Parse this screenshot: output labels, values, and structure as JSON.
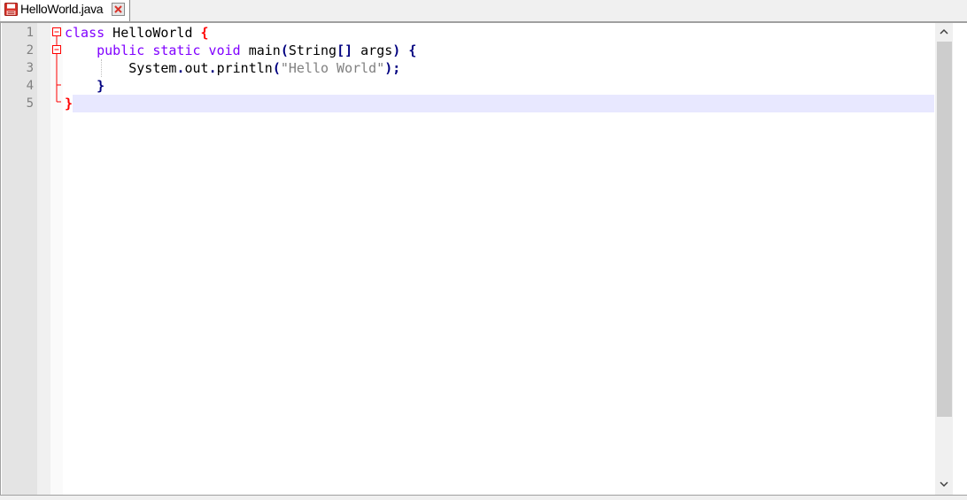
{
  "tab": {
    "label": "HelloWorld.java",
    "icon": "save-icon",
    "close_icon": "close-icon"
  },
  "editor": {
    "line_numbers": [
      "1",
      "2",
      "3",
      "4",
      "5"
    ],
    "lines": [
      {
        "indent": "",
        "tokens": [
          {
            "t": "class",
            "c": "kw"
          },
          {
            "t": " HelloWorld ",
            "c": ""
          },
          {
            "t": "{",
            "c": "brace-red"
          }
        ]
      },
      {
        "indent": "    ",
        "tokens": [
          {
            "t": "public static void",
            "c": "kw"
          },
          {
            "t": " main",
            "c": ""
          },
          {
            "t": "(",
            "c": "op"
          },
          {
            "t": "String",
            "c": ""
          },
          {
            "t": "[]",
            "c": "op"
          },
          {
            "t": " args",
            "c": ""
          },
          {
            "t": ")",
            "c": "op"
          },
          {
            "t": " {",
            "c": "brace"
          }
        ]
      },
      {
        "indent": "        ",
        "tokens": [
          {
            "t": "System",
            "c": ""
          },
          {
            "t": ".",
            "c": "op"
          },
          {
            "t": "out",
            "c": ""
          },
          {
            "t": ".",
            "c": "op"
          },
          {
            "t": "println",
            "c": ""
          },
          {
            "t": "(",
            "c": "op"
          },
          {
            "t": "\"Hello World\"",
            "c": "str"
          },
          {
            "t": ");",
            "c": "op"
          }
        ]
      },
      {
        "indent": "    ",
        "tokens": [
          {
            "t": "}",
            "c": "brace"
          }
        ]
      },
      {
        "indent": "",
        "tokens": [
          {
            "t": "}",
            "c": "brace-red"
          }
        ]
      }
    ],
    "current_line": 5
  },
  "scrollbar": {
    "up_icon": "chevron-up-icon",
    "down_icon": "chevron-down-icon"
  },
  "colors": {
    "keyword": "#8000ff",
    "string": "#808080",
    "brace": "#000080",
    "fold": "#ff0000",
    "caret_line": "#e8e8ff"
  }
}
